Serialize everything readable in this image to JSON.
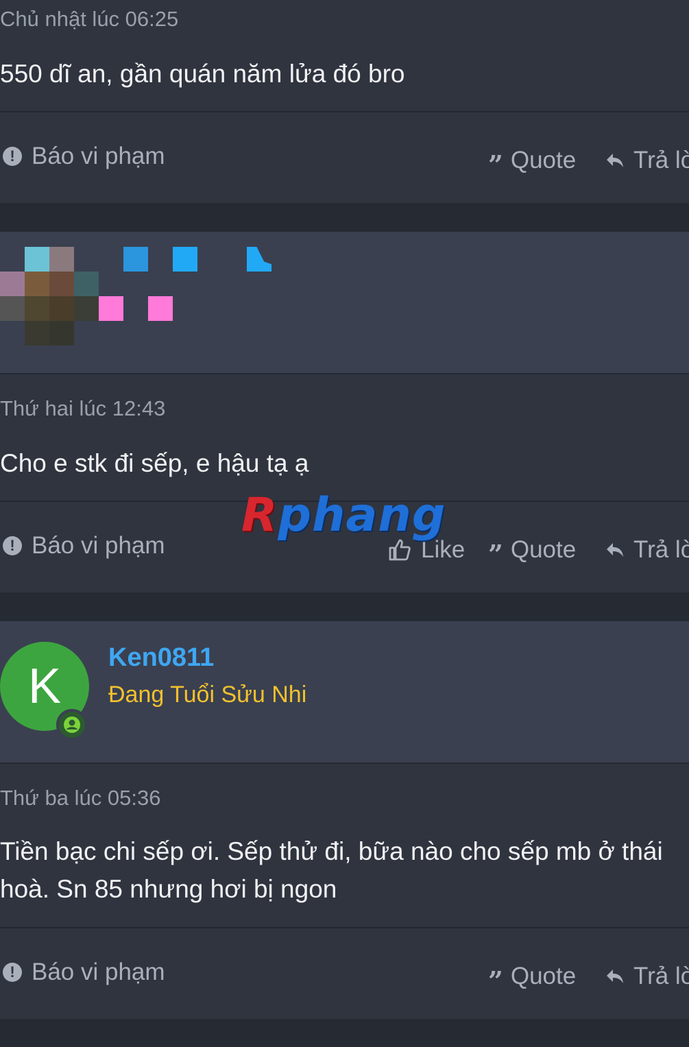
{
  "posts": [
    {
      "timestamp": "Chủ nhật lúc 06:25",
      "message": "550 dĩ an, gần quán năm lửa đó bro"
    },
    {
      "timestamp": "Thứ hai lúc 12:43",
      "message": "Cho e stk đi sếp, e hậu tạ ạ"
    },
    {
      "timestamp": "Thứ ba lúc 05:36",
      "message": "Tiền bạc chi sếp ơi. Sếp thử đi, bữa nào cho sếp mb ở thái hoà. Sn 85 nhưng hơi bị ngon"
    }
  ],
  "actions": {
    "report": "Báo vi phạm",
    "like": "Like",
    "quote": "Quote",
    "reply": "Trả lờ"
  },
  "user": {
    "initial": "K",
    "name": "Ken0811",
    "title": "Đang Tuổi Sửu Nhi"
  },
  "watermark": {
    "part1": "R",
    "part2": "phang"
  },
  "colors": {
    "background": "#2a2e38",
    "post_bg": "#30343f",
    "header_bg": "#3a4050",
    "username": "#3fa7f2",
    "usertitle": "#f2c12e",
    "avatar": "#3da540"
  }
}
